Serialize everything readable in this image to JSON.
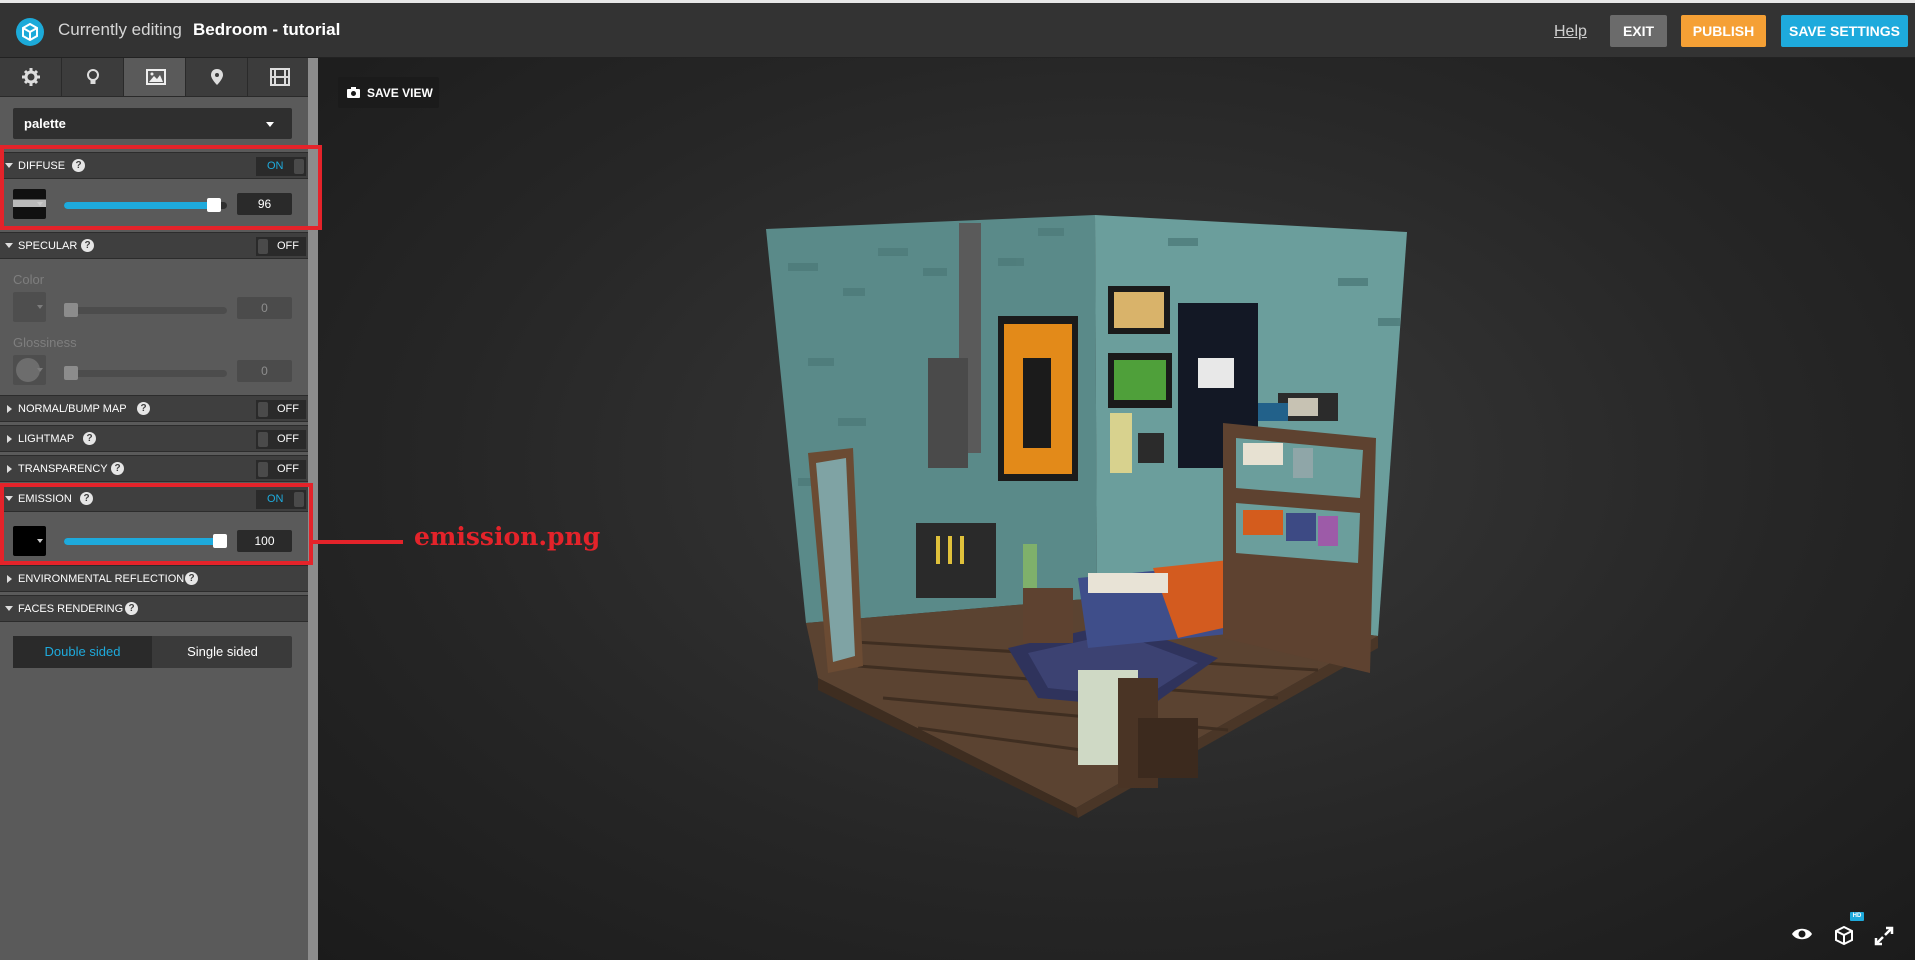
{
  "header": {
    "editing_label": "Currently editing",
    "model_title": "Bedroom - tutorial",
    "help_label": "Help",
    "exit_label": "EXIT",
    "publish_label": "PUBLISH",
    "save_settings_label": "SAVE SETTINGS"
  },
  "sidebar": {
    "tabs": [
      {
        "icon": "gear-icon",
        "active": false
      },
      {
        "icon": "lightbulb-icon",
        "active": false
      },
      {
        "icon": "image-icon",
        "active": true
      },
      {
        "icon": "map-pin-icon",
        "active": false
      },
      {
        "icon": "film-icon",
        "active": false
      }
    ],
    "material_select": "palette",
    "diffuse": {
      "label": "DIFFUSE",
      "toggle": "ON",
      "value": "96",
      "level": 96
    },
    "specular": {
      "label": "SPECULAR",
      "toggle": "OFF",
      "color_label": "Color",
      "color_value": "0",
      "glossiness_label": "Glossiness",
      "glossiness_value": "0"
    },
    "normal_bump": {
      "label": "NORMAL/BUMP MAP",
      "toggle": "OFF"
    },
    "lightmap": {
      "label": "LIGHTMAP",
      "toggle": "OFF"
    },
    "transparency": {
      "label": "TRANSPARENCY",
      "toggle": "OFF"
    },
    "emission": {
      "label": "EMISSION",
      "toggle": "ON",
      "value": "100",
      "level": 100
    },
    "env_reflection": {
      "label": "ENVIRONMENTAL REFLECTION"
    },
    "faces_rendering": {
      "label": "FACES RENDERING",
      "double_sided": "Double sided",
      "single_sided": "Single sided",
      "selected": "Double sided"
    },
    "help_glyph": "?"
  },
  "annotation": {
    "text": "emission.png",
    "color": "#e4232a"
  },
  "viewport": {
    "save_view_label": "SAVE VIEW",
    "hd_badge": "HD",
    "icons": [
      "eye-icon",
      "cube-icon",
      "fullscreen-icon"
    ]
  },
  "colors": {
    "accent": "#1eaadc",
    "publish": "#f5a035",
    "exit": "#6b6b6b"
  }
}
